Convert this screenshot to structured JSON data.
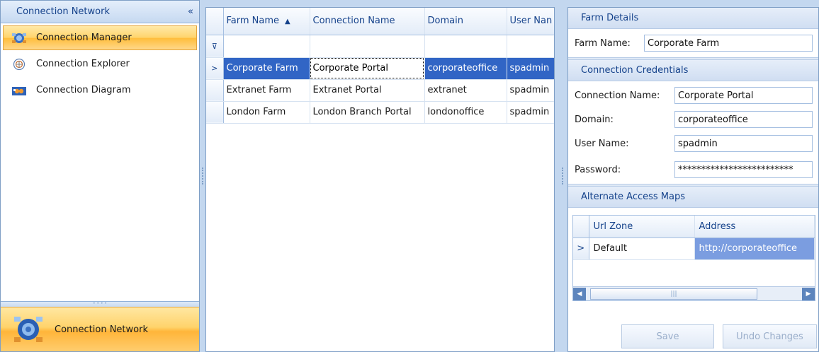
{
  "nav": {
    "header": "Connection Network",
    "collapse_glyph": "«",
    "items": [
      {
        "label": "Connection Manager",
        "icon": "globe-connection-icon",
        "active": true
      },
      {
        "label": "Connection Explorer",
        "icon": "explorer-circle-icon",
        "active": false
      },
      {
        "label": "Connection Diagram",
        "icon": "diagram-icon",
        "active": false
      }
    ],
    "splitter_glyph": "• • • •",
    "bottom_label": "Connection Network"
  },
  "grid": {
    "columns": [
      "Farm Name",
      "Connection Name",
      "Domain",
      "User Nan"
    ],
    "sort_glyph": "▲",
    "filter_glyph": "⊽",
    "row_indicator": ">",
    "rows": [
      {
        "farm": "Corporate Farm",
        "connection": "Corporate Portal",
        "domain": "corporateoffice",
        "user": "spadmin"
      },
      {
        "farm": "Extranet Farm",
        "connection": "Extranet Portal",
        "domain": "extranet",
        "user": "spadmin"
      },
      {
        "farm": "London Farm",
        "connection": "London Branch Portal",
        "domain": "londonoffice",
        "user": "spadmin"
      }
    ]
  },
  "details": {
    "farm_group": "Farm Details",
    "farm_name_label": "Farm Name:",
    "farm_name_value": "Corporate Farm",
    "cred_group": "Connection Credentials",
    "connection_name_label": "Connection Name:",
    "connection_name_value": "Corporate Portal",
    "domain_label": "Domain:",
    "domain_value": "corporateoffice",
    "user_label": "User Name:",
    "user_value": "spadmin",
    "password_label": "Password:",
    "password_value": "*************************",
    "aam_group": "Alternate Access Maps",
    "aam_columns": [
      "Url Zone",
      "Address"
    ],
    "aam_rows": [
      {
        "zone": "Default",
        "address": "http://corporateoffice"
      }
    ],
    "scroll_left": "◀",
    "scroll_right": "▶",
    "thumb_grip": "|||",
    "save_label": "Save",
    "undo_label": "Undo Changes"
  },
  "colors": {
    "selection": "#3165c5",
    "active_nav": "#ffd46b",
    "header_text": "#15428b",
    "aam_selected": "#7b9de0"
  }
}
